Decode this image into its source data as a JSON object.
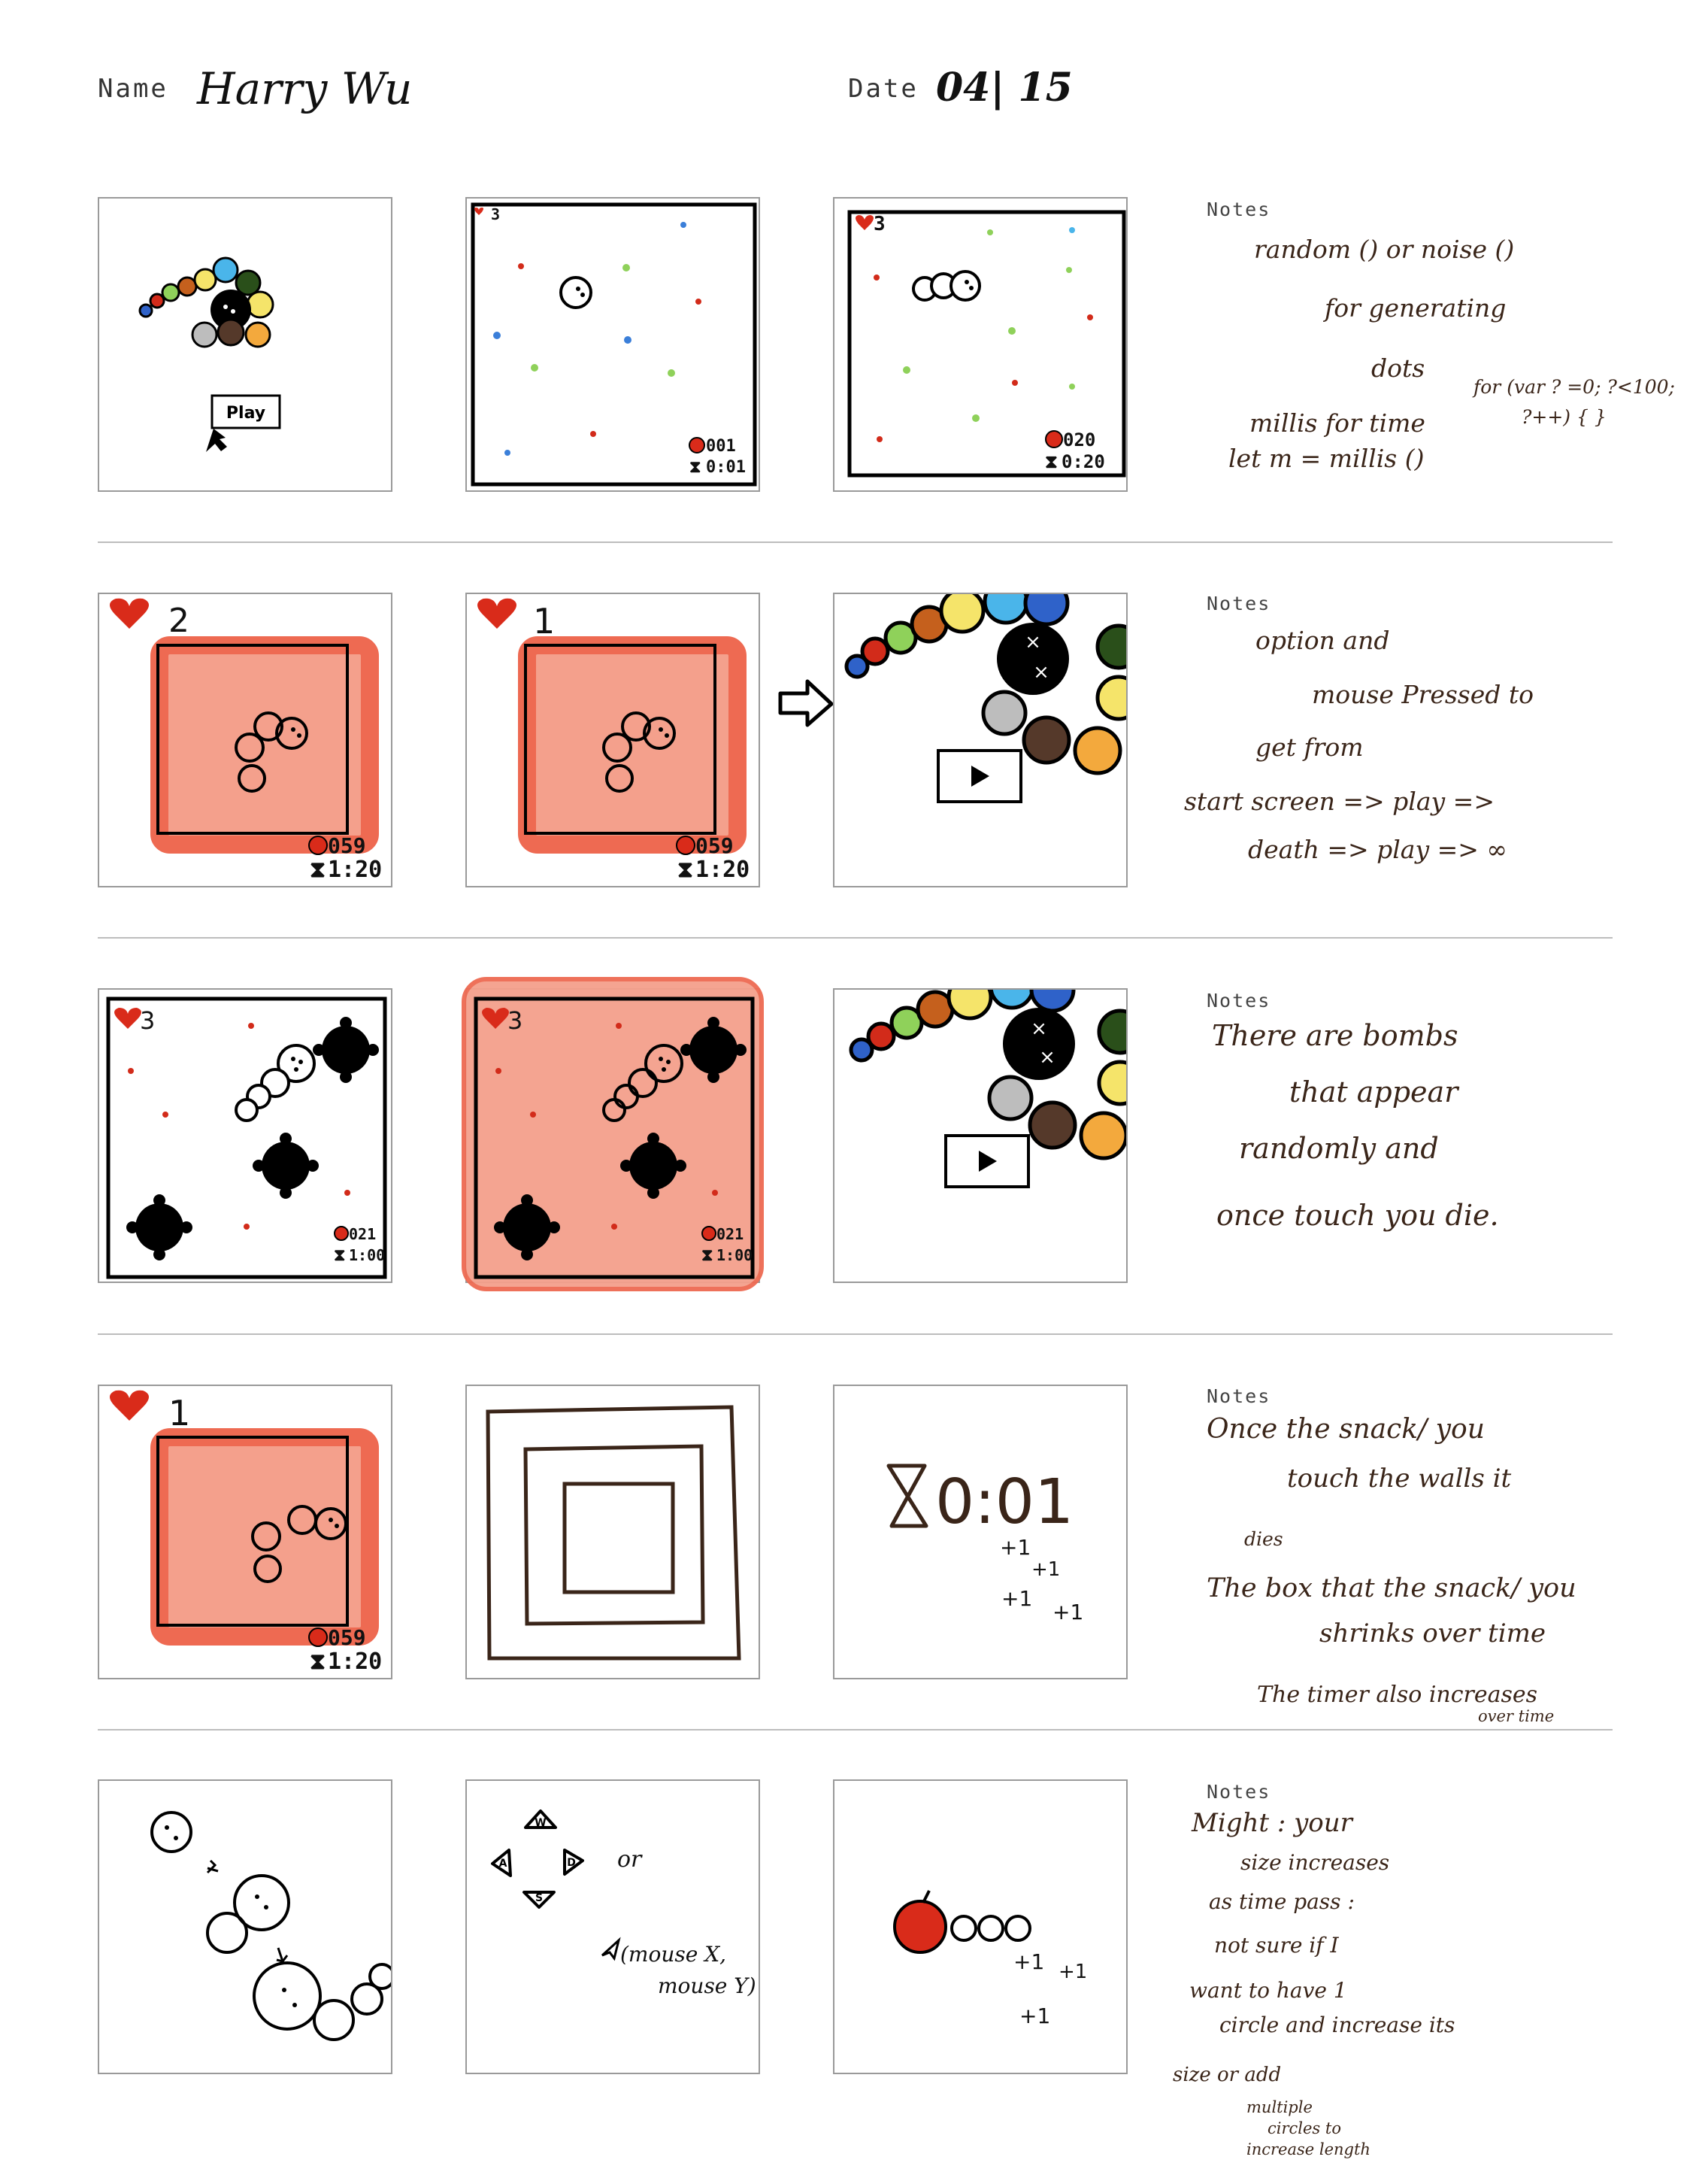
{
  "header": {
    "name_label": "Name",
    "name_value": "Harry Wu",
    "date_label": "Date",
    "date_value": "04| 15"
  },
  "notes_label": "Notes",
  "frames": {
    "start_play_label": "Play",
    "hud": {
      "lives_3": "3",
      "lives_2": "2",
      "lives_1": "1",
      "score_001": "001",
      "time_001": "0:01",
      "score_020": "020",
      "time_020": "0:20",
      "score_059": "059",
      "time_120": "1:20",
      "score_021": "021",
      "time_100": "1:00"
    },
    "timer_demo": "0:01",
    "plus_one": "+1",
    "wasd": [
      "W",
      "A",
      "S",
      "D"
    ],
    "or_text": "or",
    "mouse_text_1": "(mouse X,",
    "mouse_text_2": "mouse Y)"
  },
  "notes": {
    "row1": [
      "random () or noise ()",
      "for generating",
      "dots",
      "for (var ? =0; ?<100;",
      "?++) { }",
      "millis for time",
      "let m = millis ()"
    ],
    "row2": [
      "option and",
      "mouse Pressed to",
      "get from",
      "start screen => play =>",
      "death => play => ∞"
    ],
    "row3": [
      "There are bombs",
      "that appear",
      "randomly and",
      "once touch you die."
    ],
    "row4": [
      "Once the snack/ you",
      "touch the walls it",
      "dies",
      "The box that the snack/ you",
      "shrinks over time",
      "The timer also increases",
      "over time"
    ],
    "row5": [
      "Might : your",
      "size increases",
      "as time pass :",
      "not sure if I",
      "want to have 1",
      "circle and increase its",
      "size or add",
      "multiple",
      "circles to",
      "increase length"
    ]
  },
  "colors": {
    "heart": "#d92b1a",
    "damage_overlay": "#f4a08c",
    "damage_border": "#ee6a52",
    "dot_red": "#d22b1a",
    "dot_green": "#8fd15a",
    "dot_blue": "#3b7fd9",
    "note_ink": "#3a2519"
  }
}
